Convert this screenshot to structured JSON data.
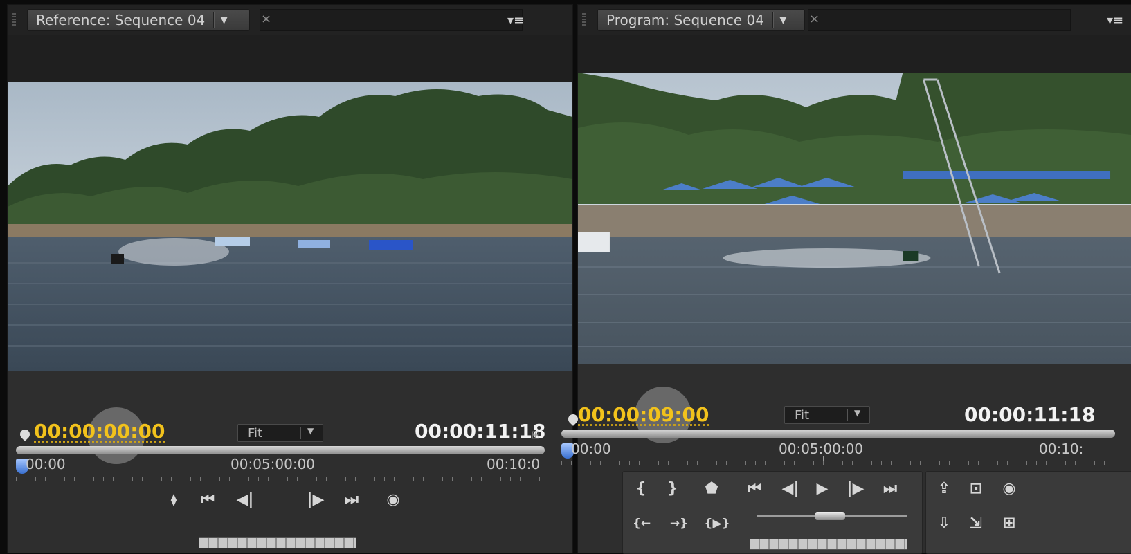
{
  "reference_monitor": {
    "tab_title": "Reference: Sequence 04",
    "tab_dropdown_icon": "▼",
    "close_icon": "×",
    "panel_menu_icon": "▾≡",
    "current_timecode": "00:00:00:00",
    "zoom_select": "Fit",
    "duration_timecode": "00:00:11:18",
    "ruler_labels": [
      "00:00",
      "00:05:00:00",
      "00:10:0"
    ],
    "buttons": [
      "⧫",
      "⏮",
      "◀|",
      "|▶",
      "⏭",
      "◉"
    ],
    "button_icons": [
      "marker-gang-icon",
      "go-to-in-icon",
      "step-back-icon",
      "step-forward-icon",
      "go-to-out-icon",
      "output-icon"
    ]
  },
  "program_monitor": {
    "tab_title": "Program: Sequence 04",
    "tab_dropdown_icon": "▼",
    "close_icon": "×",
    "panel_menu_icon": "▾≡",
    "current_timecode": "00:00:09:00",
    "zoom_select": "Fit",
    "duration_timecode": "00:00:11:18",
    "ruler_labels": [
      "00:00",
      "00:05:00:00",
      "00:10:"
    ],
    "transport_row1": [
      "{",
      "}",
      "⬟",
      "⏮",
      "◀|",
      "▶",
      "|▶",
      "⏭"
    ],
    "transport_row1_icons": [
      "mark-in-icon",
      "mark-out-icon",
      "add-marker-icon",
      "go-to-in-icon",
      "step-back-icon",
      "play-icon",
      "step-forward-icon",
      "go-to-out-icon"
    ],
    "transport_row2": [
      "{←",
      "→}",
      "{▶}"
    ],
    "transport_row2_icons": [
      "go-to-in-point-icon",
      "go-to-out-point-icon",
      "play-in-to-out-icon"
    ],
    "edit_buttons": [
      "⇪",
      "⊡",
      "◉",
      "⇩",
      "⇲",
      "⊞"
    ],
    "edit_button_icons": [
      "lift-icon",
      "safe-margins-icon",
      "output-icon",
      "extract-icon",
      "trim-icon",
      "multicam-icon"
    ]
  },
  "colors": {
    "timecode_accent": "#f2c21c",
    "panel_bg": "#2c2c2c"
  }
}
